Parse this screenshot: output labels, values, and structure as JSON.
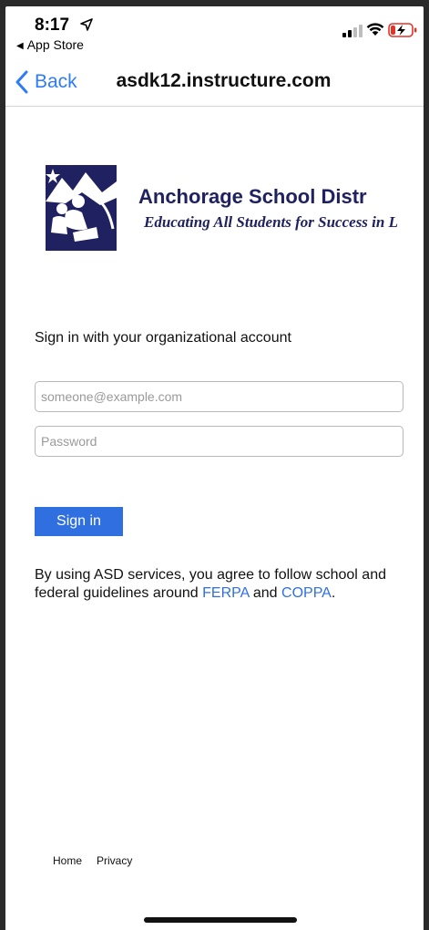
{
  "status_bar": {
    "time": "8:17",
    "back_app_label": "App Store"
  },
  "nav": {
    "back_label": "Back",
    "title": "asdk12.instructure.com"
  },
  "logo": {
    "name": "Anchorage School Distr",
    "tagline": "Educating All Students for Success in L"
  },
  "form": {
    "heading": "Sign in with your organizational account",
    "email_placeholder": "someone@example.com",
    "password_placeholder": "Password",
    "signin_label": "Sign in"
  },
  "terms": {
    "text_before": "By using ASD services, you agree to follow school and federal guidelines around ",
    "ferpa_link": "FERPA",
    "middle": " and ",
    "coppa_link": "COPPA",
    "end": "."
  },
  "footer": {
    "home_label": "Home",
    "privacy_label": "Privacy"
  },
  "colors": {
    "accent": "#2f6fe0",
    "nav_accent": "#2f7cf6",
    "logo_navy": "#1f2160"
  }
}
